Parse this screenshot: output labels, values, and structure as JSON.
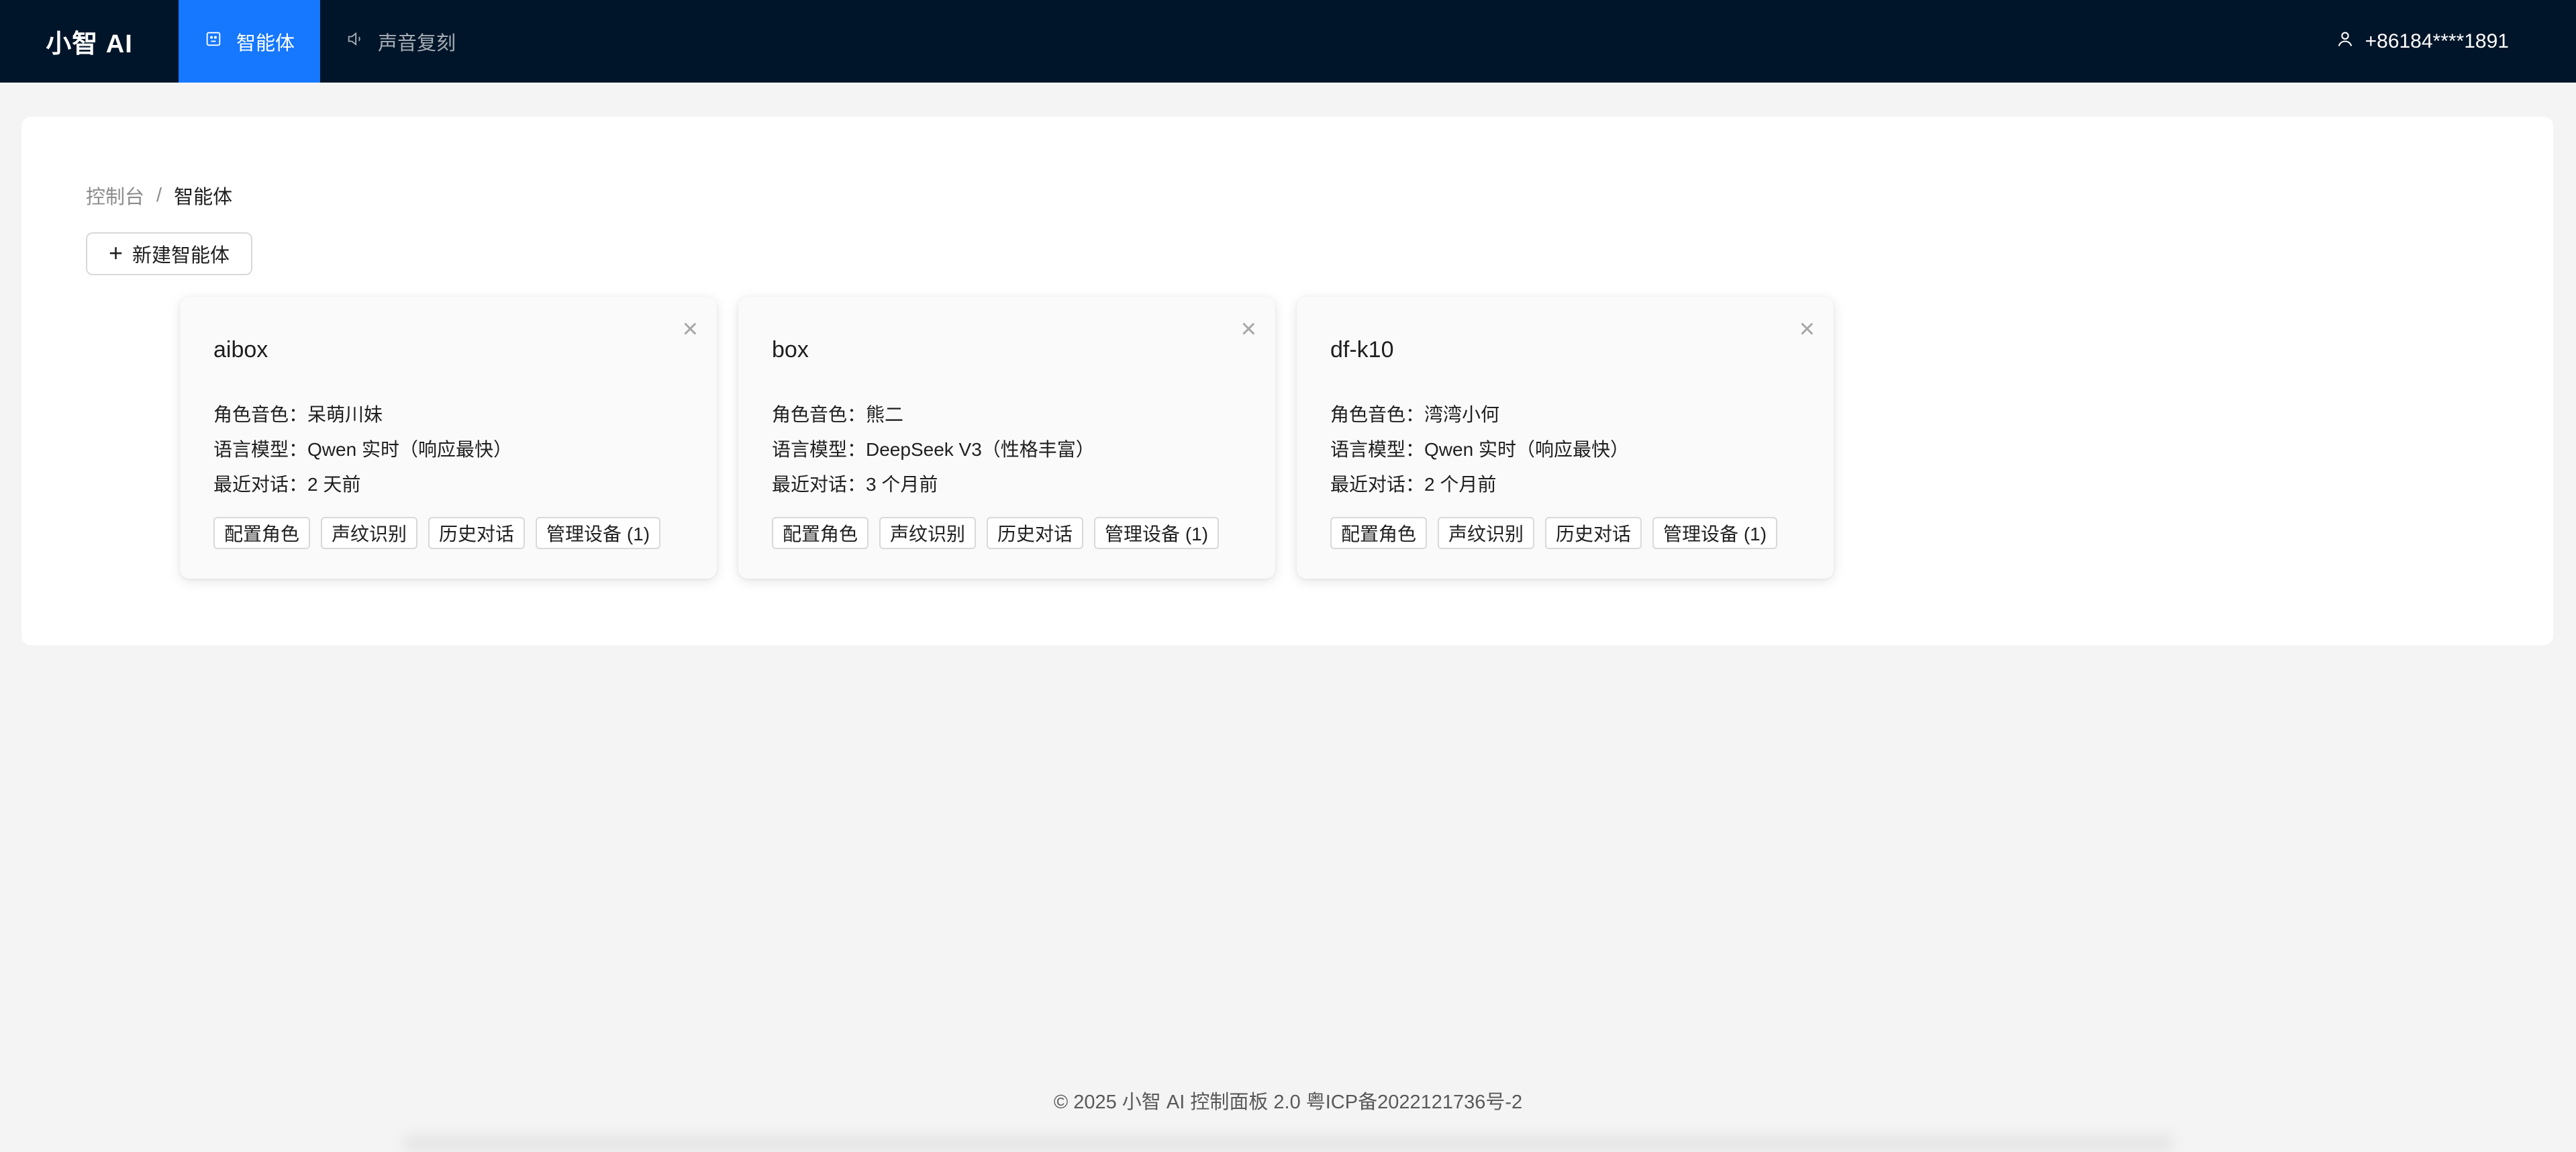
{
  "header": {
    "brand": "小智 AI",
    "nav": [
      {
        "label": "智能体",
        "icon": "robot-icon",
        "active": true
      },
      {
        "label": "声音复刻",
        "icon": "speaker-icon",
        "active": false
      }
    ],
    "user": {
      "label": "+86184****1891",
      "icon": "user-icon"
    }
  },
  "breadcrumb": {
    "root": "控制台",
    "separator": "/",
    "current": "智能体"
  },
  "new_agent_button": {
    "icon": "plus-icon",
    "label": "新建智能体"
  },
  "agents": [
    {
      "name": "aibox",
      "voice_label": "角色音色：",
      "voice": "呆萌川妹",
      "model_label": "语言模型：",
      "model": "Qwen 实时（响应最快）",
      "last_label": "最近对话：",
      "last": "2 天前",
      "actions": [
        "配置角色",
        "声纹识别",
        "历史对话",
        "管理设备 (1)"
      ]
    },
    {
      "name": "box",
      "voice_label": "角色音色：",
      "voice": "熊二",
      "model_label": "语言模型：",
      "model": "DeepSeek V3（性格丰富）",
      "last_label": "最近对话：",
      "last": "3 个月前",
      "actions": [
        "配置角色",
        "声纹识别",
        "历史对话",
        "管理设备 (1)"
      ]
    },
    {
      "name": "df-k10",
      "voice_label": "角色音色：",
      "voice": "湾湾小何",
      "model_label": "语言模型：",
      "model": "Qwen 实时（响应最快）",
      "last_label": "最近对话：",
      "last": "2 个月前",
      "actions": [
        "配置角色",
        "声纹识别",
        "历史对话",
        "管理设备 (1)"
      ]
    }
  ],
  "footer": "© 2025 小智 AI 控制面板 2.0 粤ICP备2022121736号-2",
  "colors": {
    "header_bg": "#001529",
    "accent": "#1677ff",
    "page_bg": "#f4f4f4"
  }
}
